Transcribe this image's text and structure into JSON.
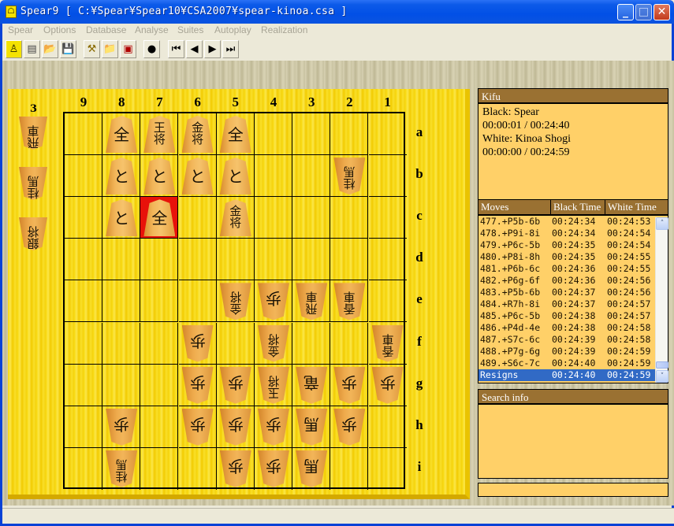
{
  "window": {
    "title": "Spear9 [ C:¥Spear¥Spear10¥CSA2007¥spear-kinoa.csa ]",
    "app_icon": "shogi-piece-icon",
    "controls": {
      "minimize": "_",
      "maximize": "□",
      "close": "✕"
    }
  },
  "menu": [
    "Spear",
    "Options",
    "Database",
    "Analyse",
    "Suites",
    "Autoplay",
    "Realization"
  ],
  "toolbar": [
    {
      "icon": "shogi-piece-icon",
      "glyph": "♙"
    },
    {
      "icon": "grid-table-icon",
      "glyph": "▤"
    },
    {
      "icon": "open-folder-icon",
      "glyph": "📂"
    },
    {
      "icon": "save-disk-icon",
      "glyph": "💾"
    },
    {
      "icon": "settings-wrench-icon",
      "glyph": "⚒"
    },
    {
      "icon": "folder-icon",
      "glyph": "📁"
    },
    {
      "icon": "save-red-disk-icon",
      "glyph": "▣"
    },
    {
      "icon": "bomb-icon",
      "glyph": "●"
    },
    {
      "icon": "first-move-icon",
      "glyph": "⏮"
    },
    {
      "icon": "previous-move-icon",
      "glyph": "◀"
    },
    {
      "icon": "next-move-icon",
      "glyph": "▶"
    },
    {
      "icon": "last-move-icon",
      "glyph": "⏭"
    }
  ],
  "board": {
    "columns": [
      "9",
      "8",
      "7",
      "6",
      "5",
      "4",
      "3",
      "2",
      "1"
    ],
    "rows": [
      "a",
      "b",
      "c",
      "d",
      "e",
      "f",
      "g",
      "h",
      "i"
    ],
    "last_move_square": "7c",
    "pieces": [
      {
        "sq": "8a",
        "side": "black",
        "kanji": "全",
        "name": "promoted-silver"
      },
      {
        "sq": "7a",
        "side": "black",
        "kanji": "王将",
        "name": "king"
      },
      {
        "sq": "6a",
        "side": "black",
        "kanji": "金将",
        "name": "gold"
      },
      {
        "sq": "5a",
        "side": "black",
        "kanji": "全",
        "name": "promoted-silver"
      },
      {
        "sq": "8b",
        "side": "black",
        "kanji": "と",
        "name": "tokin"
      },
      {
        "sq": "7b",
        "side": "black",
        "kanji": "と",
        "name": "tokin"
      },
      {
        "sq": "6b",
        "side": "black",
        "kanji": "と",
        "name": "tokin"
      },
      {
        "sq": "5b",
        "side": "black",
        "kanji": "と",
        "name": "tokin"
      },
      {
        "sq": "2b",
        "side": "white",
        "kanji": "桂馬",
        "name": "knight"
      },
      {
        "sq": "8c",
        "side": "black",
        "kanji": "と",
        "name": "tokin"
      },
      {
        "sq": "7c",
        "side": "black",
        "kanji": "全",
        "name": "promoted-silver"
      },
      {
        "sq": "5c",
        "side": "black",
        "kanji": "金将",
        "name": "gold"
      },
      {
        "sq": "5e",
        "side": "white",
        "kanji": "金将",
        "name": "gold"
      },
      {
        "sq": "4e",
        "side": "white",
        "kanji": "歩",
        "name": "pawn"
      },
      {
        "sq": "3e",
        "side": "white",
        "kanji": "飛車",
        "name": "rook"
      },
      {
        "sq": "2e",
        "side": "white",
        "kanji": "香車",
        "name": "lance"
      },
      {
        "sq": "6f",
        "side": "white",
        "kanji": "歩",
        "name": "pawn"
      },
      {
        "sq": "4f",
        "side": "white",
        "kanji": "金将",
        "name": "gold"
      },
      {
        "sq": "1f",
        "side": "white",
        "kanji": "香車",
        "name": "lance"
      },
      {
        "sq": "6g",
        "side": "white",
        "kanji": "歩",
        "name": "pawn"
      },
      {
        "sq": "5g",
        "side": "white",
        "kanji": "歩",
        "name": "pawn"
      },
      {
        "sq": "4g",
        "side": "white",
        "kanji": "玉将",
        "name": "king"
      },
      {
        "sq": "3g",
        "side": "white",
        "kanji": "竜",
        "name": "dragon"
      },
      {
        "sq": "2g",
        "side": "white",
        "kanji": "歩",
        "name": "pawn"
      },
      {
        "sq": "1g",
        "side": "white",
        "kanji": "歩",
        "name": "pawn"
      },
      {
        "sq": "8h",
        "side": "white",
        "kanji": "歩",
        "name": "pawn"
      },
      {
        "sq": "6h",
        "side": "white",
        "kanji": "歩",
        "name": "pawn"
      },
      {
        "sq": "5h",
        "side": "white",
        "kanji": "歩",
        "name": "pawn"
      },
      {
        "sq": "4h",
        "side": "white",
        "kanji": "歩",
        "name": "pawn"
      },
      {
        "sq": "3h",
        "side": "white",
        "kanji": "馬",
        "name": "horse"
      },
      {
        "sq": "2h",
        "side": "white",
        "kanji": "歩",
        "name": "pawn"
      },
      {
        "sq": "8i",
        "side": "white",
        "kanji": "桂馬",
        "name": "knight"
      },
      {
        "sq": "5i",
        "side": "white",
        "kanji": "歩",
        "name": "pawn"
      },
      {
        "sq": "4i",
        "side": "white",
        "kanji": "歩",
        "name": "pawn"
      },
      {
        "sq": "3i",
        "side": "white",
        "kanji": "馬",
        "name": "horse"
      }
    ]
  },
  "white_hand": {
    "count_label": "3",
    "pieces": [
      {
        "kanji": "飛車",
        "name": "rook"
      },
      {
        "kanji": "桂馬",
        "name": "knight"
      },
      {
        "kanji": "銀将",
        "name": "silver"
      }
    ]
  },
  "kifu": {
    "header": "Kifu",
    "black_label": "Black: Spear",
    "black_time": "00:00:01 / 00:24:40",
    "white_label": "White: Kinoa Shogi",
    "white_time": "00:00:00 / 00:24:59"
  },
  "moves": {
    "headers": [
      "Moves",
      "Black Time",
      "White Time"
    ],
    "rows": [
      [
        "477.+P5b-6b",
        "00:24:34",
        "00:24:53"
      ],
      [
        "478.+P9i-8i",
        "00:24:34",
        "00:24:54"
      ],
      [
        "479.+P6c-5b",
        "00:24:35",
        "00:24:54"
      ],
      [
        "480.+P8i-8h",
        "00:24:35",
        "00:24:55"
      ],
      [
        "481.+P6b-6c",
        "00:24:36",
        "00:24:55"
      ],
      [
        "482.+P6g-6f",
        "00:24:36",
        "00:24:56"
      ],
      [
        "483.+P5b-6b",
        "00:24:37",
        "00:24:56"
      ],
      [
        "484.+R7h-8i",
        "00:24:37",
        "00:24:57"
      ],
      [
        "485.+P6c-5b",
        "00:24:38",
        "00:24:57"
      ],
      [
        "486.+P4d-4e",
        "00:24:38",
        "00:24:58"
      ],
      [
        "487.+S7c-6c",
        "00:24:39",
        "00:24:58"
      ],
      [
        "488.+P7g-6g",
        "00:24:39",
        "00:24:59"
      ],
      [
        "489.+S6c-7c",
        "00:24:40",
        "00:24:59"
      ],
      [
        "Resigns",
        "00:24:40",
        "00:24:59"
      ]
    ],
    "selected_index": 13,
    "scroll_up": "˄",
    "scroll_down": "˅"
  },
  "search_info": {
    "header": "Search info",
    "content": ""
  },
  "status_box": "",
  "statusbar": ""
}
